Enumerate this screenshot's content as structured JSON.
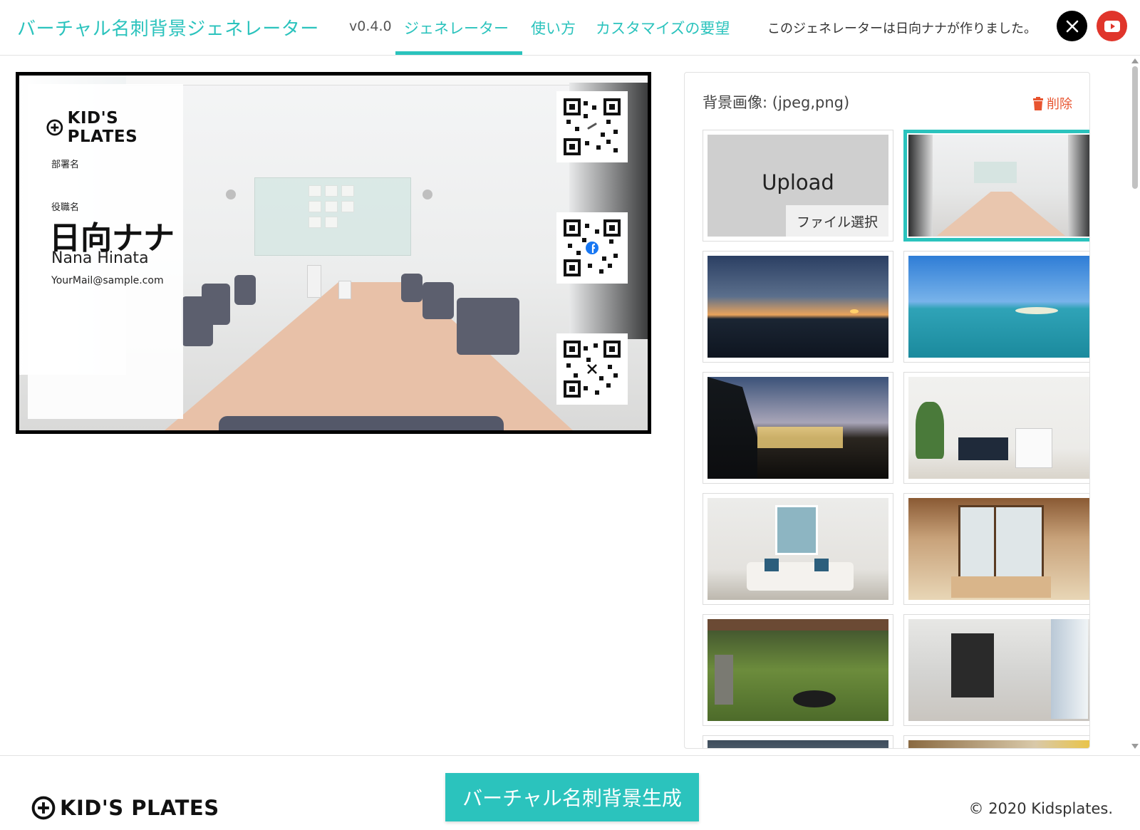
{
  "header": {
    "brand": "バーチャル名刺背景ジェネレーター",
    "version": "v0.4.0",
    "nav": {
      "generator": "ジェネレーター",
      "howto": "使い方",
      "custom": "カスタマイズの要望"
    },
    "credit": "このジェネレーターは日向ナナが作りました。"
  },
  "card": {
    "logo": "KID'S PLATES",
    "department": "部署名",
    "role": "役職名",
    "name_jp": "日向ナナ",
    "name_en": "Nana Hinata",
    "email": "YourMail@sample.com",
    "qr_icons": [
      "link-icon",
      "facebook-icon",
      "x-icon"
    ]
  },
  "panel": {
    "title": "背景画像: (jpeg,png)",
    "delete_label": "削除",
    "upload_label": "Upload",
    "file_select_label": "ファイル選択",
    "thumbnails": [
      "upload",
      "conference-room",
      "sunset-sea",
      "blue-lagoon",
      "night-town",
      "modern-living",
      "blue-living",
      "japanese-room",
      "japanese-garden",
      "office-corridor",
      "office-interior",
      "warm-interior"
    ]
  },
  "footer": {
    "logo": "KID'S PLATES",
    "generate_label": "バーチャル名刺背景生成",
    "copyright": "© 2020 Kidsplates."
  },
  "colors": {
    "accent": "#2bc3bd",
    "delete": "#e8542f",
    "youtube": "#e0352b"
  }
}
